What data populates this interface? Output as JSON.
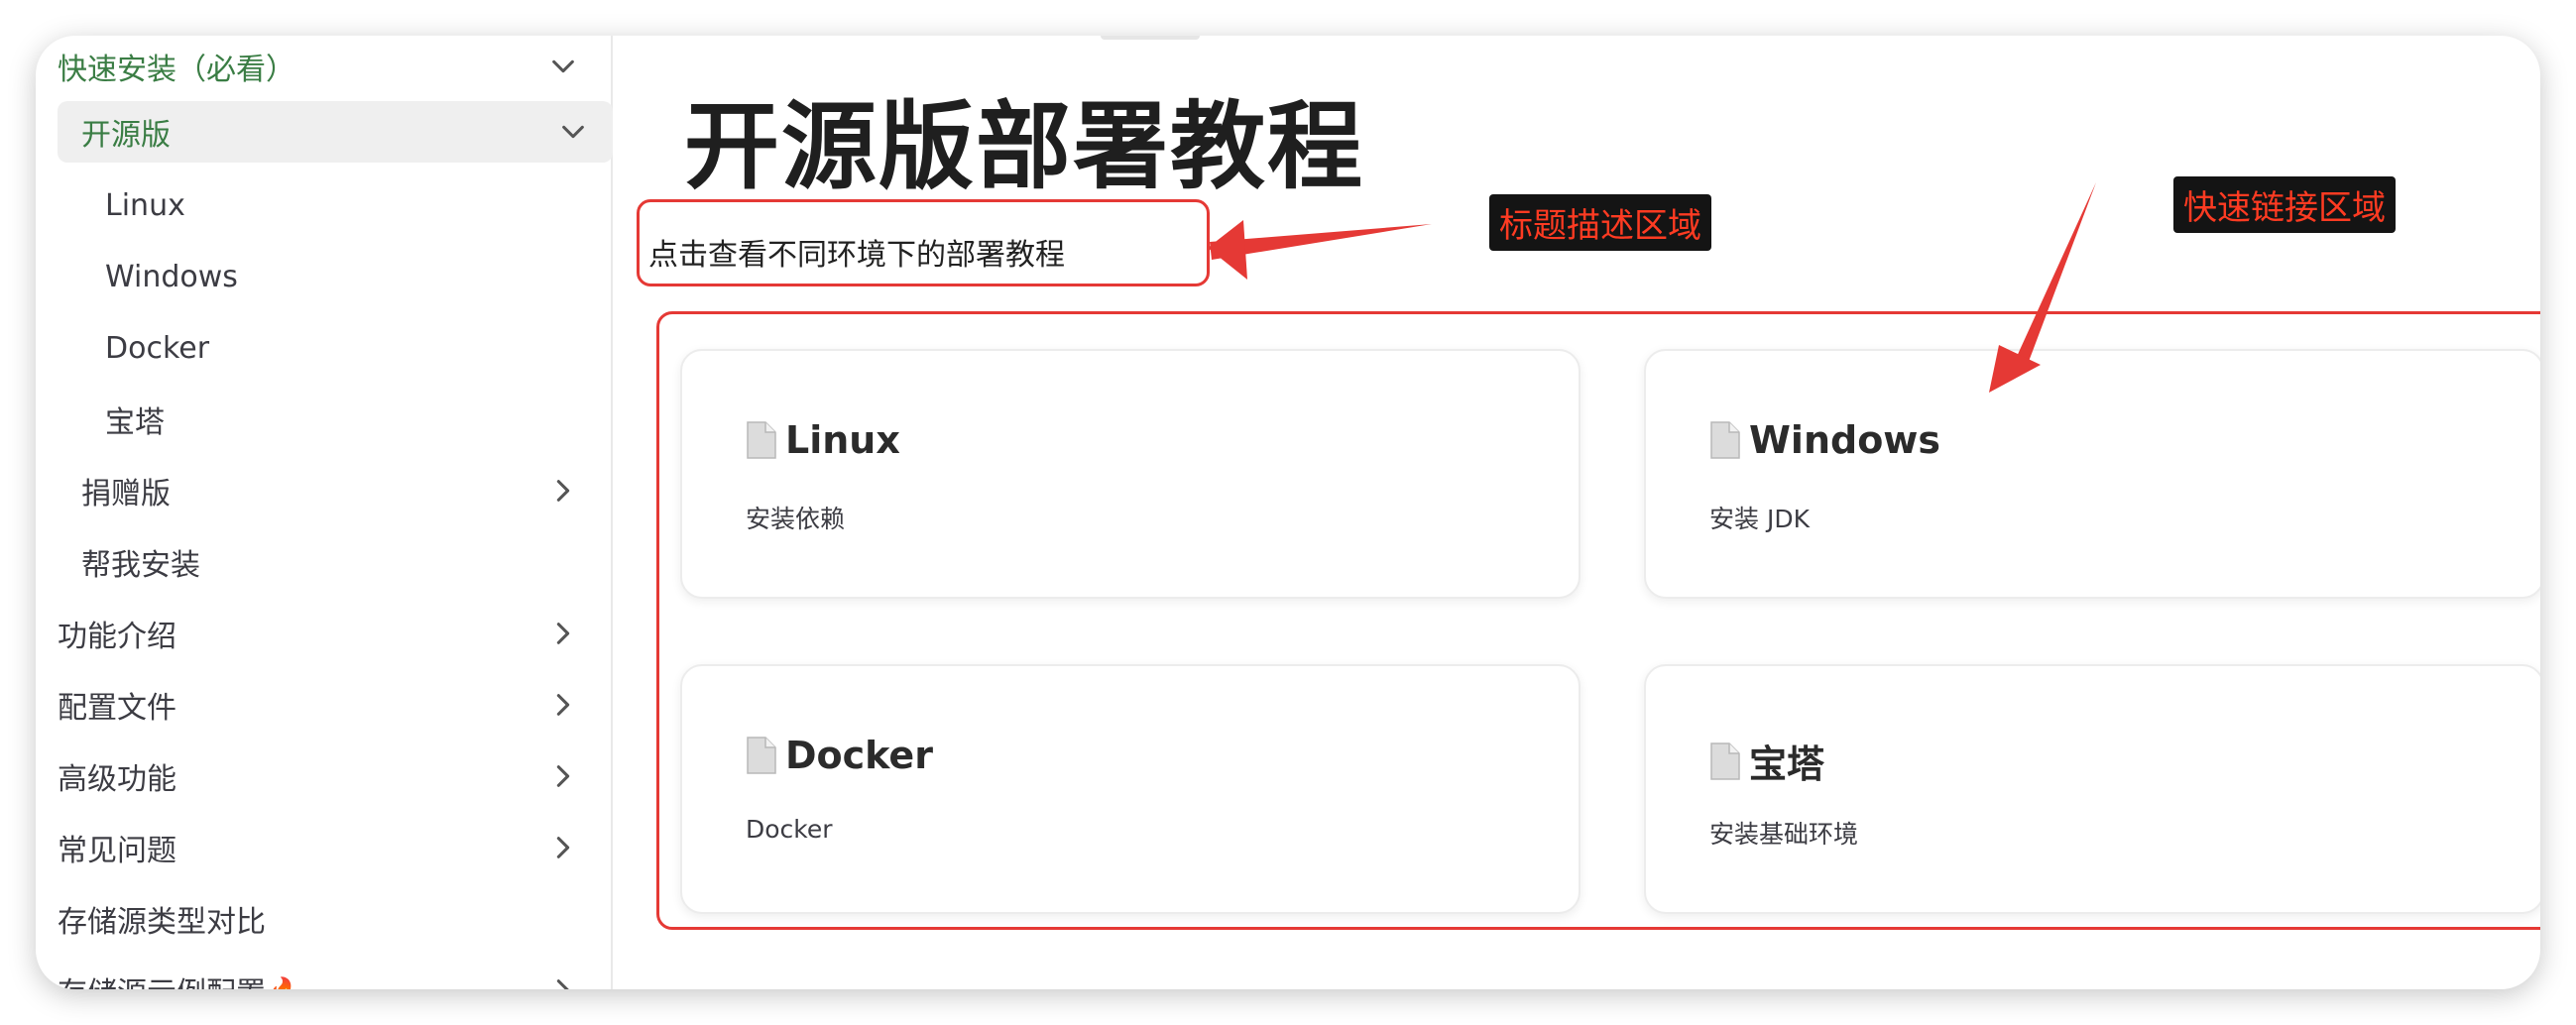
{
  "sidebar": {
    "items": [
      {
        "label": "快速安装（必看）"
      },
      {
        "label": "开源版"
      },
      {
        "label": "Linux"
      },
      {
        "label": "Windows"
      },
      {
        "label": "Docker"
      },
      {
        "label": "宝塔"
      },
      {
        "label": "捐赠版"
      },
      {
        "label": "帮我安装"
      },
      {
        "label": "功能介绍"
      },
      {
        "label": "配置文件"
      },
      {
        "label": "高级功能"
      },
      {
        "label": "常见问题"
      },
      {
        "label": "存储源类型对比"
      },
      {
        "label": "存储源示例配置🔥"
      }
    ]
  },
  "main": {
    "title": "开源版部署教程",
    "description": "点击查看不同环境下的部署教程",
    "cards": [
      {
        "title": "Linux",
        "desc": "安装依赖"
      },
      {
        "title": "Windows",
        "desc": "安装 JDK"
      },
      {
        "title": "Docker",
        "desc": "Docker"
      },
      {
        "title": "宝塔",
        "desc": "安装基础环境"
      }
    ]
  },
  "annotations": {
    "title_desc_label": "标题描述区域",
    "quick_links_label": "快速链接区域"
  },
  "colors": {
    "accent_green": "#3a7d44",
    "annotation_red": "#e53935",
    "label_bg": "#141414"
  },
  "icons": [
    "chevron-down-icon",
    "chevron-right-icon",
    "document-icon"
  ]
}
